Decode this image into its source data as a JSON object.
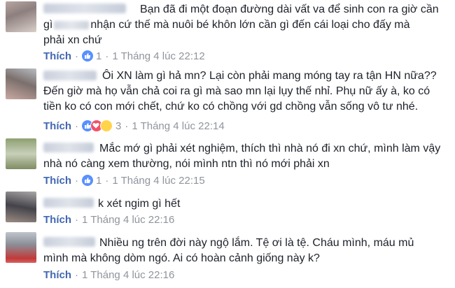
{
  "colors": {
    "like_link": "#4267b2",
    "meta": "#90949c",
    "text": "#1d2129",
    "like_badge": "#5890ff",
    "love_badge": "#f25268",
    "haha_badge": "#ffd44a"
  },
  "comments": [
    {
      "lines": [
        "Bạn đã đi một đoạn đường dài vất va để sinh con ra giờ cần",
        "gì",
        "nhận cứ thế mà nuôi bé khôn lớn cần gì đến cái loại cho đấy mà",
        "phải xn chứ"
      ],
      "like_label": "Thích",
      "reactions": [
        "like"
      ],
      "count": "1",
      "time": "1 Tháng 4 lúc 22:12"
    },
    {
      "lines": [
        "Ôi XN làm gì hả mn? Lại còn phải mang móng tay ra tận HN nữa??",
        "Đến giờ mà họ vẫn chả coi ra gì mà sao mn lại lụy thế nhỉ. Phụ nữ ấy à, ko có",
        "tiền ko có con mới chết, chứ ko có chồng với gd chồng vẫn sống vô tư nhé."
      ],
      "like_label": "Thích",
      "reactions": [
        "like",
        "love",
        "haha"
      ],
      "count": "3",
      "time": "1 Tháng 4 lúc 22:14"
    },
    {
      "lines": [
        "Mắc mớ gì phải xét nghiệm, thích thì nhà nó đi xn chứ, mình làm vậy",
        "nhà nó càng xem thường, nói mình ntn thì nó mới phải xn"
      ],
      "like_label": "Thích",
      "reactions": [
        "like"
      ],
      "count": "1",
      "time": "1 Tháng 4 lúc 22:15"
    },
    {
      "lines": [
        "k xét ngim gì hết"
      ],
      "like_label": "Thích",
      "reactions": [],
      "count": "",
      "time": "1 Tháng 4 lúc 22:16"
    },
    {
      "lines": [
        "Nhiều ng trên đời này ngộ lắm. Tệ ơi là tệ. Cháu mình, máu mủ",
        "mình mà không dòm ngó. Ai có hoàn cảnh giống này k?"
      ],
      "like_label": "Thích",
      "reactions": [],
      "count": "",
      "time": "1 Tháng 4 lúc 22:16"
    }
  ]
}
